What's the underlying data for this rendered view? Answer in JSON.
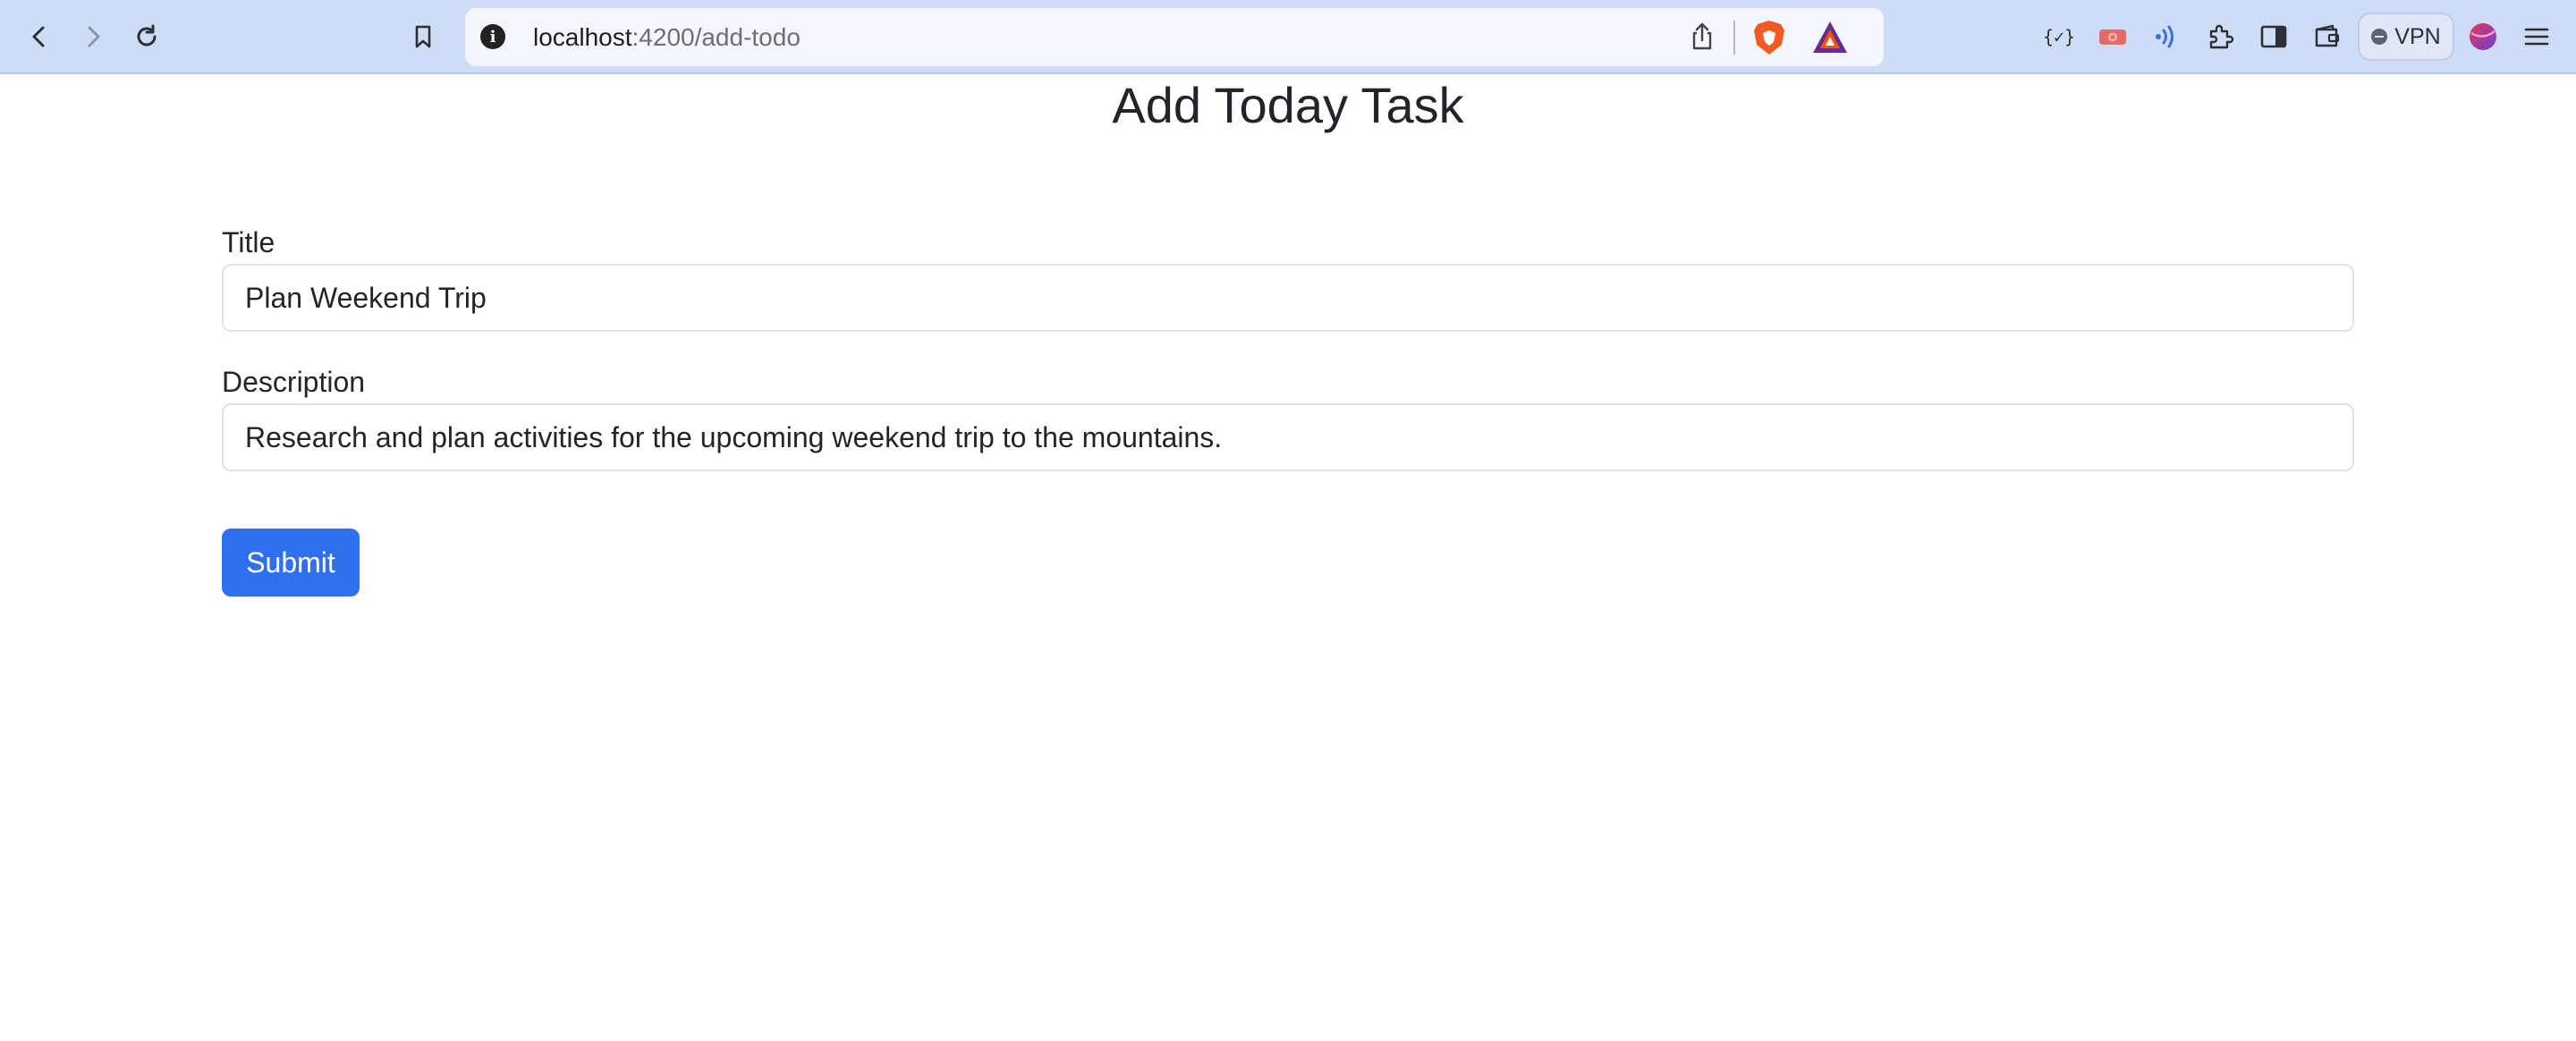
{
  "browser": {
    "url_host": "localhost",
    "url_path": ":4200/add-todo",
    "vpn_label": "VPN",
    "icons": [
      "back-icon",
      "forward-icon",
      "reload-icon",
      "bookmark-icon",
      "info-icon",
      "share-icon",
      "brave-shields-icon",
      "brave-rewards-icon",
      "json-extension-icon",
      "screen-recorder-icon",
      "speech-extension-icon",
      "extensions-icon",
      "sidebar-icon",
      "wallet-icon",
      "vpn-icon",
      "profile-avatar-icon",
      "menu-icon"
    ],
    "accent_color": "#cfdcf5"
  },
  "page": {
    "title": "Add Today Task"
  },
  "form": {
    "title_label": "Title",
    "title_value": "Plan Weekend Trip",
    "description_label": "Description",
    "description_value": "Research and plan activities for the upcoming weekend trip to the mountains.",
    "submit_label": "Submit",
    "submit_color": "#2f6ff0"
  }
}
